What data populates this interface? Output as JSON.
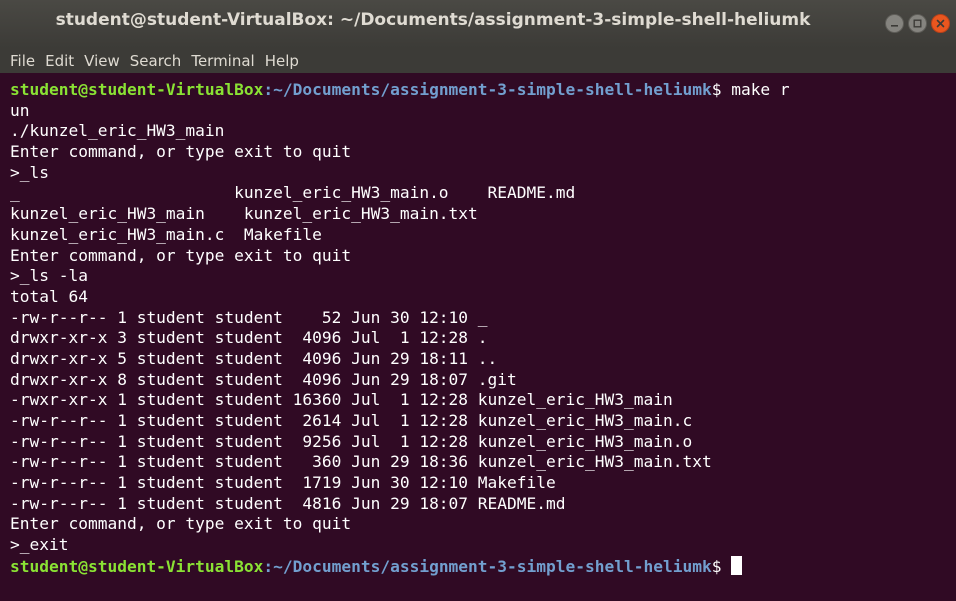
{
  "window": {
    "title": "student@student-VirtualBox: ~/Documents/assignment-3-simple-shell-heliumk"
  },
  "menu": [
    "File",
    "Edit",
    "View",
    "Search",
    "Terminal",
    "Help"
  ],
  "prompt": {
    "user_host": "student@student-VirtualBox",
    "path": ":~/Documents/assignment-3-simple-shell-heliumk",
    "symbol": "$"
  },
  "terminal": {
    "first_command": " make r",
    "lines": [
      "un",
      "./kunzel_eric_HW3_main",
      "Enter command, or type exit to quit",
      ">_ls",
      "_                      kunzel_eric_HW3_main.o    README.md",
      "kunzel_eric_HW3_main    kunzel_eric_HW3_main.txt",
      "kunzel_eric_HW3_main.c  Makefile",
      "Enter command, or type exit to quit",
      ">_ls -la",
      "total 64",
      "-rw-r--r-- 1 student student    52 Jun 30 12:10 _",
      "drwxr-xr-x 3 student student  4096 Jul  1 12:28 .",
      "drwxr-xr-x 5 student student  4096 Jun 29 18:11 ..",
      "drwxr-xr-x 8 student student  4096 Jun 29 18:07 .git",
      "-rwxr-xr-x 1 student student 16360 Jul  1 12:28 kunzel_eric_HW3_main",
      "-rw-r--r-- 1 student student  2614 Jul  1 12:28 kunzel_eric_HW3_main.c",
      "-rw-r--r-- 1 student student  9256 Jul  1 12:28 kunzel_eric_HW3_main.o",
      "-rw-r--r-- 1 student student   360 Jun 29 18:36 kunzel_eric_HW3_main.txt",
      "-rw-r--r-- 1 student student  1719 Jun 30 12:10 Makefile",
      "-rw-r--r-- 1 student student  4816 Jun 29 18:07 README.md",
      "Enter command, or type exit to quit",
      ">_exit"
    ],
    "last_command": " "
  },
  "colors": {
    "background": "#300a24",
    "user": "#8ae234",
    "path": "#729fcf",
    "text": "#ffffff"
  }
}
